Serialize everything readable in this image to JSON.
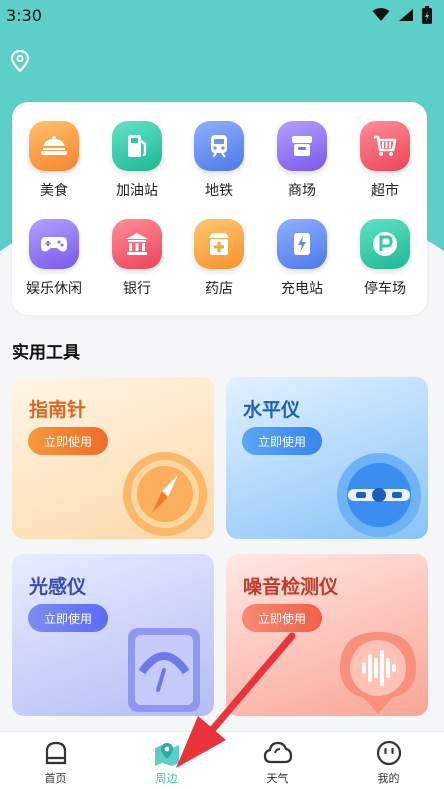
{
  "status_bar": {
    "time": "3:30"
  },
  "colors": {
    "brand": "#5ccfc9",
    "active_tab": "#3cbcb6",
    "arrow": "#e8343a"
  },
  "categories": [
    {
      "label": "美食",
      "icon": "food-dome-icon",
      "color": "#f59a2e"
    },
    {
      "label": "加油站",
      "icon": "gas-station-icon",
      "color": "#2ec9a6"
    },
    {
      "label": "地铁",
      "icon": "subway-icon",
      "color": "#5b8cf2"
    },
    {
      "label": "商场",
      "icon": "mall-icon",
      "color": "#8a6cf0"
    },
    {
      "label": "超市",
      "icon": "cart-icon",
      "color": "#f25a6a"
    },
    {
      "label": "娱乐休闲",
      "icon": "gamepad-icon",
      "color": "#8a6cf0"
    },
    {
      "label": "银行",
      "icon": "bank-icon",
      "color": "#f25a6a"
    },
    {
      "label": "药店",
      "icon": "pharmacy-icon",
      "color": "#f5a534"
    },
    {
      "label": "充电站",
      "icon": "charging-station-icon",
      "color": "#5b8cf2"
    },
    {
      "label": "停车场",
      "icon": "parking-icon",
      "color": "#2ec9a6"
    }
  ],
  "tools_section": {
    "title": "实用工具"
  },
  "tools": [
    {
      "title": "指南针",
      "button": "立即使用",
      "icon": "compass-icon"
    },
    {
      "title": "水平仪",
      "button": "立即使用",
      "icon": "level-icon"
    },
    {
      "title": "光感仪",
      "button": "立即使用",
      "icon": "light-meter-icon"
    },
    {
      "title": "噪音检测仪",
      "button": "立即使用",
      "icon": "sound-wave-icon"
    }
  ],
  "tabbar": [
    {
      "label": "首页",
      "icon": "home-icon",
      "active": false
    },
    {
      "label": "周边",
      "icon": "map-pin-icon",
      "active": true
    },
    {
      "label": "天气",
      "icon": "cloud-icon",
      "active": false
    },
    {
      "label": "我的",
      "icon": "face-icon",
      "active": false
    }
  ]
}
